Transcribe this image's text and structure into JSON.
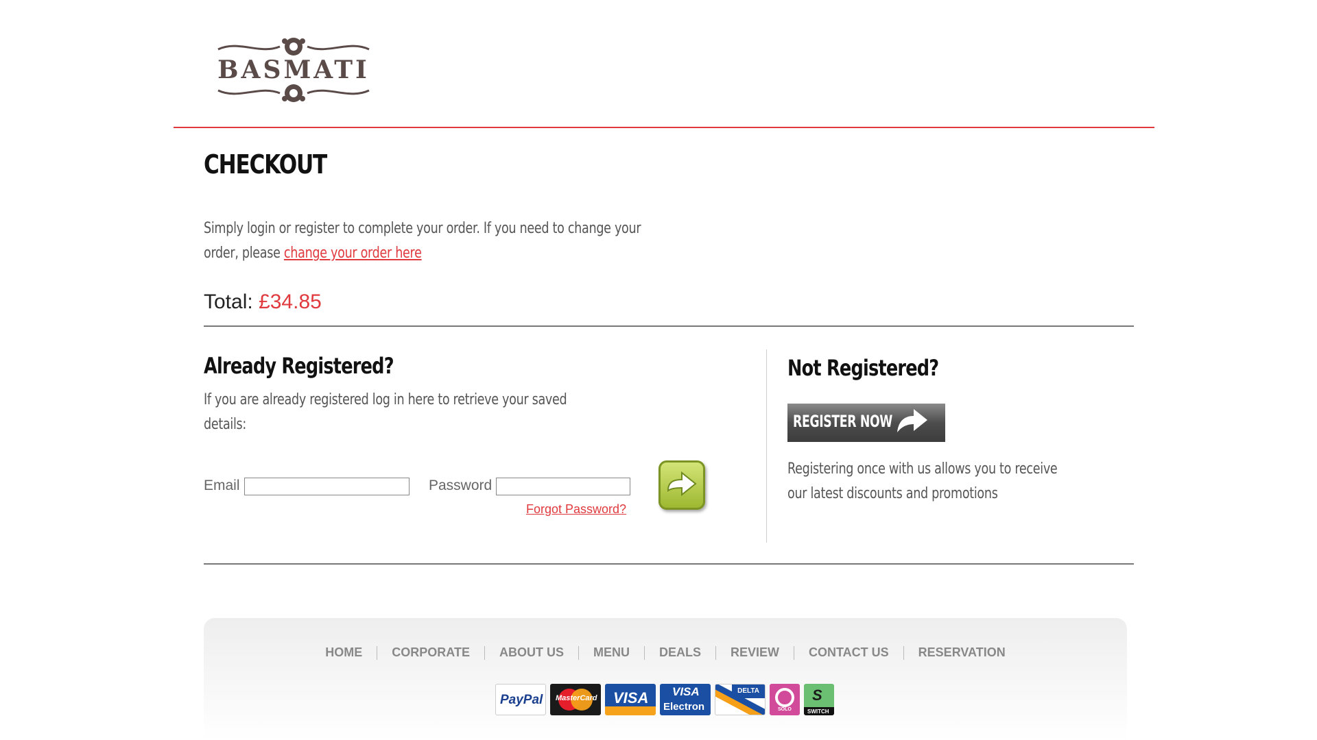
{
  "header": {
    "logo_text": "BASMATI",
    "brand_color": "#e03a3e"
  },
  "checkout": {
    "title": "CHECKOUT",
    "intro_text": "Simply login or register to complete your order. If you need to change your order, please ",
    "change_link": "change your order here",
    "total_label": "Total:",
    "total_amount": "£34.85"
  },
  "already_registered": {
    "title": "Already Registered?",
    "description": "If you are already registered log in here to retrieve your saved details:",
    "email_label": "Email",
    "email_value": "",
    "password_label": "Password",
    "password_value": "",
    "forgot_link": "Forgot Password?",
    "submit_icon": "arrow-right-icon"
  },
  "not_registered": {
    "title": "Not Registered?",
    "register_button": "REGISTER NOW",
    "register_icon": "curved-arrow-icon",
    "description": "Registering once with us allows you to receive our latest discounts and promotions"
  },
  "footer": {
    "nav": [
      "HOME",
      "CORPORATE",
      "ABOUT US",
      "MENU",
      "DEALS",
      "REVIEW",
      "CONTACT US",
      "RESERVATION"
    ],
    "payment_cards": {
      "paypal": "PayPal",
      "mastercard": "MasterCard",
      "visa": "VISA",
      "visa_electron_top": "VISA",
      "visa_electron_bottom": "Electron",
      "delta": "DELTA",
      "solo": "SOLO",
      "switch": "SWITCH"
    }
  }
}
